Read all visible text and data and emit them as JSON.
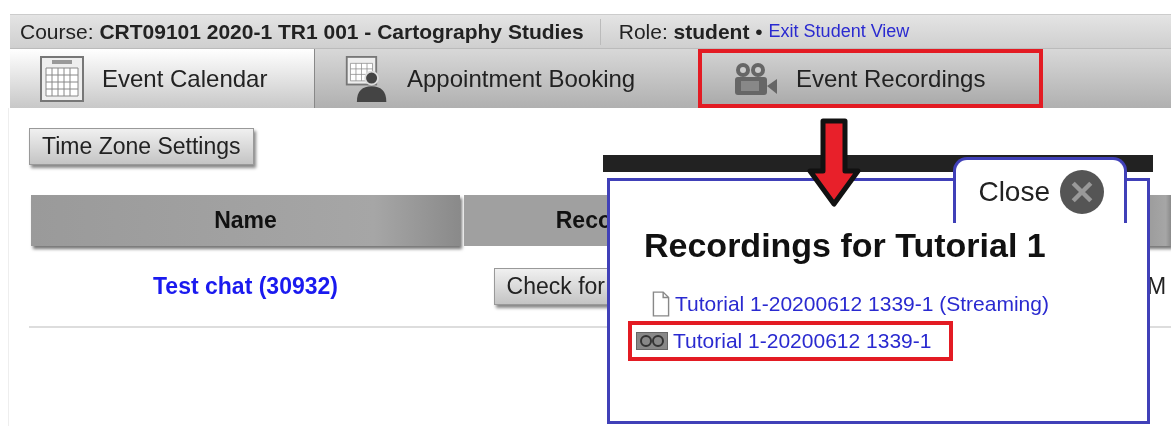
{
  "course_bar": {
    "course_label": "Course:",
    "course_name": "CRT09101 2020-1 TR1 001 - Cartography Studies",
    "role_label": "Role:",
    "role": "student",
    "separator": "•",
    "exit_link": "Exit Student View"
  },
  "tabs": [
    {
      "label": "Event Calendar",
      "kind": "calendar",
      "selected": true,
      "highlighted": false
    },
    {
      "label": "Appointment Booking",
      "kind": "booking",
      "selected": false,
      "highlighted": false
    },
    {
      "label": "Event Recordings",
      "kind": "recordings",
      "selected": false,
      "highlighted": true
    }
  ],
  "time_zone_button": "Time Zone Settings",
  "table": {
    "columns": [
      "Name",
      "Reco"
    ],
    "rows": [
      {
        "name": "Test chat (30932)",
        "action": "Check for",
        "column_3": "M"
      }
    ]
  },
  "popup": {
    "title": "Recordings for Tutorial 1",
    "close": "Close",
    "recordings": [
      {
        "label": "Tutorial 1-20200612 1339-1 (Streaming)",
        "kind": "file",
        "highlighted": false
      },
      {
        "label": "Tutorial 1-20200612 1339-1",
        "kind": "tape",
        "highlighted": true
      }
    ]
  }
}
